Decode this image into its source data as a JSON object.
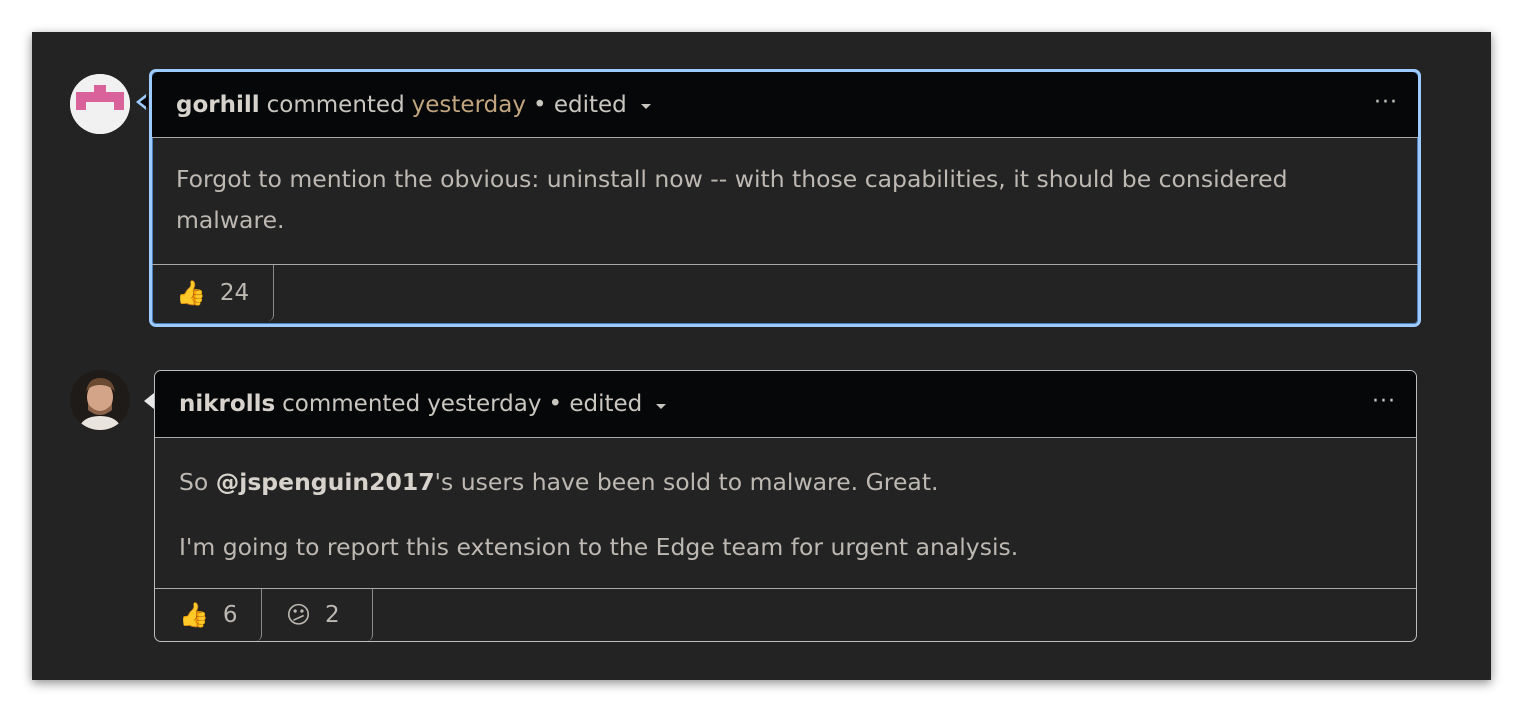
{
  "comments": [
    {
      "author": "gorhill",
      "action": "commented",
      "time": "yesterday",
      "edited": "• edited",
      "more": "···",
      "paragraphs": [
        "Forgot to mention the obvious: uninstall now -- with those capabilities, it should be considered malware."
      ],
      "reactions": [
        {
          "emoji": "👍",
          "icon": "thumbs-up-icon",
          "count": "24"
        }
      ],
      "highlighted": true,
      "avatar_color": "#d9629a"
    },
    {
      "author": "nikrolls",
      "action": "commented",
      "time": "yesterday",
      "edited": "• edited",
      "more": "···",
      "mention": "@jspenguin2017",
      "paragraph1_suffix": "'s users have been sold to malware. Great.",
      "paragraph1_prefix": "So ",
      "paragraph2": "I'm going to report this extension to the Edge team for urgent analysis.",
      "reactions": [
        {
          "emoji": "👍",
          "icon": "thumbs-up-icon",
          "count": "6"
        },
        {
          "emoji": "😕",
          "icon": "confused-face-icon",
          "count": "2"
        }
      ],
      "highlighted": false
    }
  ],
  "colors": {
    "panel_bg": "#232323",
    "header_bg": "#060708",
    "highlight_border": "#9ecbff",
    "time_color": "#c1a57f"
  }
}
